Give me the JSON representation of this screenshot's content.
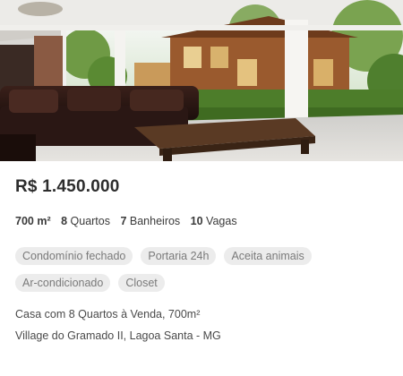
{
  "listing": {
    "price": "R$ 1.450.000",
    "features": [
      {
        "value": "700 m²",
        "label": ""
      },
      {
        "value": "8",
        "label": " Quartos"
      },
      {
        "value": "7",
        "label": " Banheiros"
      },
      {
        "value": "10",
        "label": " Vagas"
      }
    ],
    "tags": [
      "Condomínio fechado",
      "Portaria 24h",
      "Aceita animais",
      "Ar-condicionado",
      "Closet"
    ],
    "description": "Casa com 8 Quartos à Venda, 700m²",
    "address": "Village do Gramado II, Lagoa Santa - MG"
  },
  "photo": {
    "icon": "property-photo",
    "colors": {
      "sky": "#e9f0ea",
      "foliage": "#5d8a3a",
      "house": "#9a5a2e",
      "sofa": "#2a1714",
      "floor": "#d8d6d2",
      "table": "#4a3120"
    }
  }
}
